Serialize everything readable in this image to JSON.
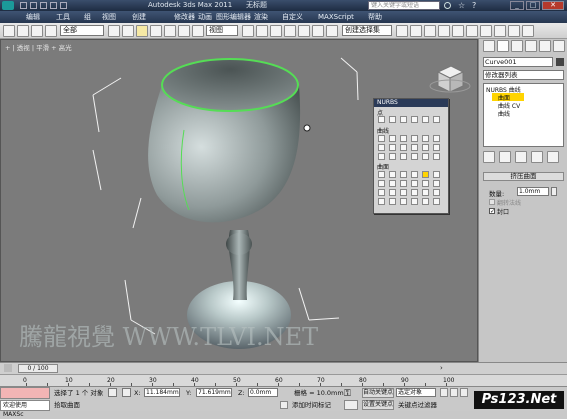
{
  "title": {
    "app": "Autodesk 3ds Max  2011",
    "doc": "无标题",
    "search_placeholder": "键入关键字或短语"
  },
  "menu": [
    "编辑",
    "工具",
    "组",
    "视图",
    "创建",
    "修改器",
    "动画",
    "图形编辑器",
    "渲染",
    "自定义",
    "MAXScript",
    "帮助"
  ],
  "toolbar": {
    "selection_filter": "全部",
    "ref_coord": "视图",
    "named_sel": "创建选择集"
  },
  "viewport": {
    "label": "+ | 透视 | 平滑 + 高光"
  },
  "nurbs": {
    "title": "NURBS",
    "section_points": "点",
    "section_curves": "曲线",
    "section_surfaces": "曲面"
  },
  "panel": {
    "object_name": "Curve001",
    "modifier_list": "修改器列表",
    "stack": [
      "NURBS 曲线",
      "曲面",
      "曲线 CV",
      "曲线"
    ],
    "rollout_title": "挤压曲面",
    "amount_label": "数量:",
    "amount_value": "1.0mm",
    "flip_label": "翻转法线",
    "cap_label": "封口"
  },
  "timeline": {
    "frame_label": "0 / 100"
  },
  "ruler_ticks": [
    "0",
    "10",
    "20",
    "30",
    "40",
    "50",
    "60",
    "70",
    "80",
    "90",
    "100"
  ],
  "status": {
    "selected": "选择了 1 个 对象",
    "prompt": "拾取曲面",
    "welcome": "欢迎使用 MAXSc",
    "x_label": "X:",
    "x_value": "11.184mm",
    "y_label": "Y:",
    "y_value": "71.619mm",
    "z_label": "Z:",
    "z_value": "0.0mm",
    "grid": "栅格 = 10.0mm",
    "add_tag": "添加时间标记",
    "auto_key": "自动关键点",
    "set_key": "设置关键点",
    "sel_obj": "选定对象",
    "key_filter": "关键点过滤器"
  },
  "watermark": "騰龍視覺 WWW.TLVI.NET",
  "corner_logo": "Ps123.Net",
  "colors": {
    "selection": "#55dd55",
    "viewport_bg": "#7b7b7b",
    "title_bg": "#26364f",
    "stack_highlight": "#ffd400"
  }
}
